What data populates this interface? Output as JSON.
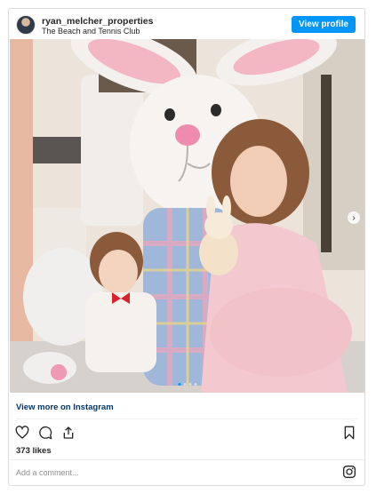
{
  "header": {
    "username": "ryan_melcher_properties",
    "location": "The Beach and Tennis Club",
    "view_profile_label": "View profile"
  },
  "post": {
    "carousel_total": 4,
    "carousel_active": 1
  },
  "footer": {
    "view_more_label": "View more on Instagram",
    "likes": "373 likes",
    "comment_placeholder": "Add a comment..."
  },
  "colors": {
    "accent": "#0095f6",
    "link": "#00376b",
    "border": "#dbdbdb"
  },
  "icons": [
    "heart-icon",
    "comment-icon",
    "share-icon",
    "bookmark-icon",
    "instagram-icon",
    "chevron-right-icon"
  ]
}
